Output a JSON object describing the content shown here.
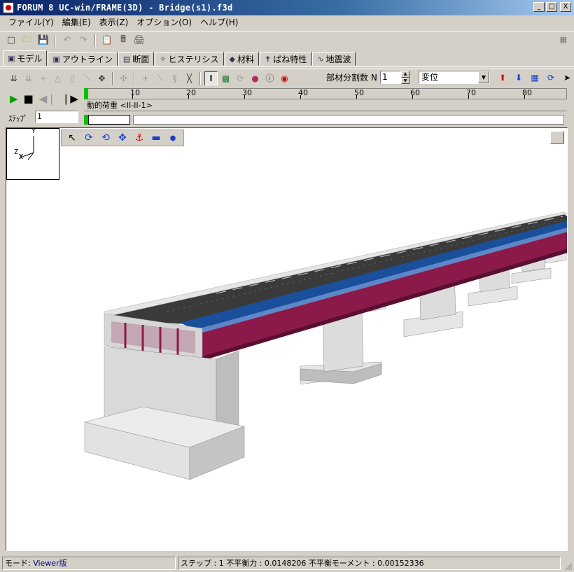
{
  "window": {
    "title": "FORUM 8  UC-win/FRAME(3D) - Bridge(s1).f3d",
    "minimize": "_",
    "maximize": "□",
    "close": "X"
  },
  "menu": [
    {
      "label": "ファイル(Y)"
    },
    {
      "label": "編集(E)"
    },
    {
      "label": "表示(Z)"
    },
    {
      "label": "オプション(O)"
    },
    {
      "label": "ヘルプ(H)"
    }
  ],
  "tabs": [
    {
      "label": "モデル",
      "icon": "model-icon"
    },
    {
      "label": "アウトライン",
      "icon": "outline-icon"
    },
    {
      "label": "断面",
      "icon": "section-icon"
    },
    {
      "label": "ヒステリシス",
      "icon": "hysteresis-icon"
    },
    {
      "label": "材料",
      "icon": "material-icon"
    },
    {
      "label": "ばね特性",
      "icon": "spring-icon"
    },
    {
      "label": "地震波",
      "icon": "wave-icon"
    }
  ],
  "toolbar2": {
    "division_label": "部材分割数 N",
    "division_value": "1",
    "display_select": "変位"
  },
  "player": {
    "step_label": "ｽﾃｯﾌﾟ",
    "step_value": "1"
  },
  "ruler": {
    "labels": [
      "10",
      "20",
      "30",
      "40",
      "50",
      "60",
      "70",
      "80"
    ]
  },
  "load_case": "動的荷重 <II-II-1>",
  "status": {
    "mode_label": "モード: ",
    "mode_value": "Viewer版",
    "step_text": "ステップ : 1  不平衡力 : 0.0148206  不平衡モーメント : 0.00152336"
  },
  "axes": {
    "y": "Y",
    "z": "Z",
    "x": "X"
  },
  "colors": {
    "girder": "#8b1a4a",
    "deck_blue": "#1a4f9c",
    "concrete": "#dcdcdc",
    "asphalt": "#3a3a3a"
  }
}
